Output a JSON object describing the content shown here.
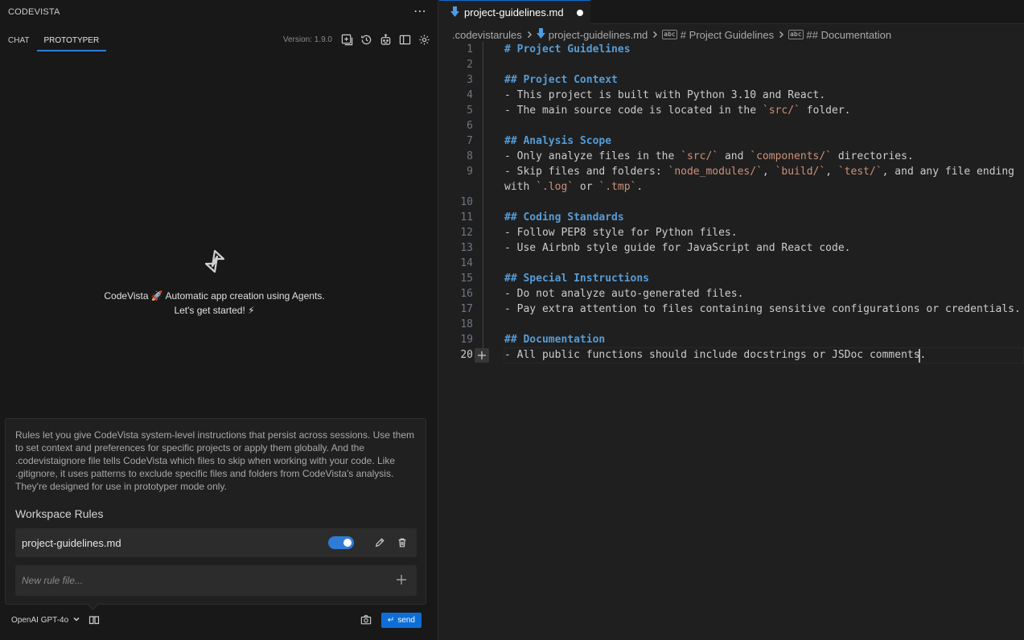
{
  "panel": {
    "title": "CODEVISTA",
    "more_icon": "ellipsis-icon",
    "tabs": [
      {
        "label": "CHAT",
        "active": false
      },
      {
        "label": "PROTOTYPER",
        "active": true
      }
    ],
    "version": "Version: 1.9.0",
    "toolbar_icons": [
      "new-chat-icon",
      "history-icon",
      "robot-icon",
      "layout-icon",
      "gear-icon"
    ]
  },
  "welcome": {
    "line1": "CodeVista 🚀 Automatic app creation using Agents.",
    "line2": "Let's get started! ⚡"
  },
  "rules": {
    "description": "Rules let you give CodeVista system-level instructions that persist across sessions. Use them to set context and preferences for specific projects or apply them globally. And the .codevistaignore file tells CodeVista which files to skip when working with your code. Like .gitignore, it uses patterns to exclude specific files and folders from CodeVista's analysis. They're designed for use in prototyper mode only.",
    "heading": "Workspace Rules",
    "items": [
      {
        "name": "project-guidelines.md",
        "enabled": true
      }
    ],
    "new_rule_placeholder": "New rule file..."
  },
  "composer": {
    "model": "OpenAI GPT-4o",
    "send_label": "send",
    "send_glyph": "↵"
  },
  "editor": {
    "tab_label": "project-guidelines.md",
    "dirty": true,
    "breadcrumb": [
      ".codevistarules",
      "project-guidelines.md",
      "# Project Guidelines",
      "## Documentation"
    ],
    "current_line": 20,
    "lines": [
      {
        "n": "1",
        "text": "# Project Guidelines"
      },
      {
        "n": "2",
        "text": ""
      },
      {
        "n": "3",
        "text": "## Project Context"
      },
      {
        "n": "4",
        "text": "- This project is built with Python 3.10 and React."
      },
      {
        "n": "5",
        "text": "- The main source code is located in the `src/` folder."
      },
      {
        "n": "6",
        "text": ""
      },
      {
        "n": "7",
        "text": "## Analysis Scope"
      },
      {
        "n": "8",
        "text": "- Only analyze files in the `src/` and `components/` directories."
      },
      {
        "n": "9",
        "text": "- Skip files and folders: `node_modules/`, `build/`, `test/`, and any file ending"
      },
      {
        "n": "",
        "text": "with `.log` or `.tmp`."
      },
      {
        "n": "10",
        "text": ""
      },
      {
        "n": "11",
        "text": "## Coding Standards"
      },
      {
        "n": "12",
        "text": "- Follow PEP8 style for Python files."
      },
      {
        "n": "13",
        "text": "- Use Airbnb style guide for JavaScript and React code."
      },
      {
        "n": "14",
        "text": ""
      },
      {
        "n": "15",
        "text": "## Special Instructions"
      },
      {
        "n": "16",
        "text": "- Do not analyze auto-generated files."
      },
      {
        "n": "17",
        "text": "- Pay extra attention to files containing sensitive configurations or credentials."
      },
      {
        "n": "18",
        "text": ""
      },
      {
        "n": "19",
        "text": "## Documentation"
      },
      {
        "n": "20",
        "text": "- All public functions should include docstrings or JSDoc comments."
      }
    ]
  },
  "colors": {
    "accent": "#0e6ed6",
    "heading": "#569cd6",
    "code_span": "#ce9178"
  }
}
